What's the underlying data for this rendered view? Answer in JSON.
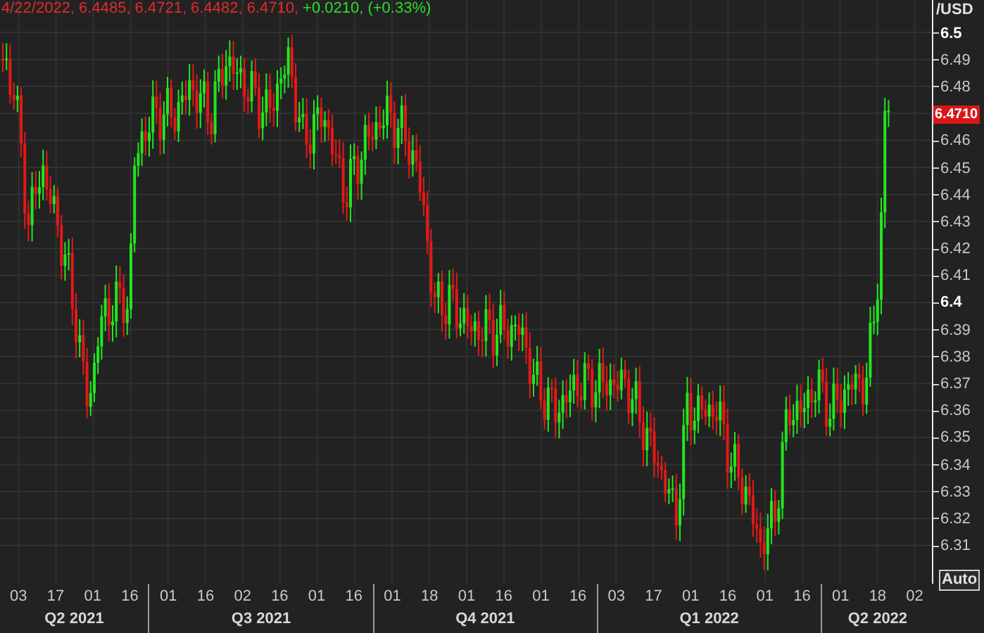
{
  "header": {
    "quote": "4/22/2022, 6.4485, 6.4721, 6.4482, 6.4710,",
    "change": "+0.0210, (+0.33%)"
  },
  "y_axis": {
    "unit": "/USD",
    "labels": [
      {
        "text": "6.5",
        "kind": "tick",
        "major": true
      },
      {
        "text": "6.49",
        "kind": "tick",
        "major": false
      },
      {
        "text": "6.48",
        "kind": "tick",
        "major": false
      },
      {
        "text": "6.4710",
        "kind": "last_price"
      },
      {
        "text": "6.46",
        "kind": "tick",
        "major": false
      },
      {
        "text": "6.45",
        "kind": "tick",
        "major": false
      },
      {
        "text": "6.44",
        "kind": "tick",
        "major": false
      },
      {
        "text": "6.43",
        "kind": "tick",
        "major": false
      },
      {
        "text": "6.42",
        "kind": "tick",
        "major": false
      },
      {
        "text": "6.41",
        "kind": "tick",
        "major": false
      },
      {
        "text": "6.4",
        "kind": "tick",
        "major": true
      },
      {
        "text": "6.39",
        "kind": "tick",
        "major": false
      },
      {
        "text": "6.38",
        "kind": "tick",
        "major": false
      },
      {
        "text": "6.37",
        "kind": "tick",
        "major": false
      },
      {
        "text": "6.36",
        "kind": "tick",
        "major": false
      },
      {
        "text": "6.35",
        "kind": "tick",
        "major": false
      },
      {
        "text": "6.34",
        "kind": "tick",
        "major": false
      },
      {
        "text": "6.33",
        "kind": "tick",
        "major": false
      },
      {
        "text": "6.32",
        "kind": "tick",
        "major": false
      },
      {
        "text": "6.31",
        "kind": "tick",
        "major": false
      }
    ],
    "scale_button": "Auto"
  },
  "x_axis": {
    "quarters": [
      {
        "label": "Q2 2021",
        "dates": [
          "03",
          "17",
          "01",
          "16"
        ]
      },
      {
        "label": "Q3 2021",
        "dates": [
          "01",
          "16",
          "02",
          "16",
          "01",
          "16"
        ]
      },
      {
        "label": "Q4 2021",
        "dates": [
          "01",
          "18",
          "01",
          "16",
          "01",
          "16"
        ]
      },
      {
        "label": "Q1 2022",
        "dates": [
          "03",
          "17",
          "01",
          "16",
          "01",
          "16"
        ]
      },
      {
        "label": "Q2 2022",
        "dates": [
          "01",
          "18",
          "02"
        ]
      }
    ]
  }
}
